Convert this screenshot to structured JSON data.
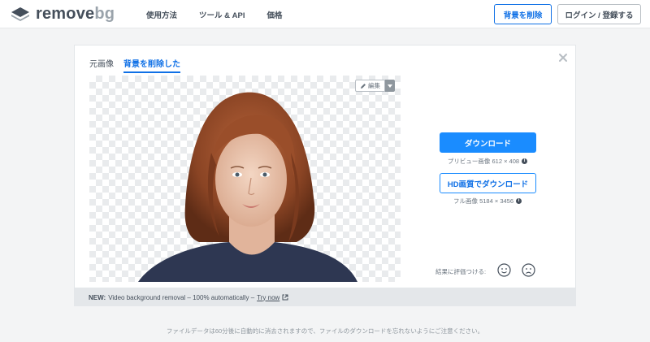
{
  "header": {
    "logo": {
      "text_main": "remove",
      "text_accent": "bg"
    },
    "nav": [
      {
        "label": "使用方法"
      },
      {
        "label": "ツール & API"
      },
      {
        "label": "価格"
      }
    ],
    "remove_bg_button": "背景を削除",
    "login_button": "ログイン / 登録する"
  },
  "card": {
    "tabs": [
      {
        "label": "元画像",
        "active": false
      },
      {
        "label": "背景を削除した",
        "active": true
      }
    ],
    "close_icon": "close-icon",
    "edit_button": "編集",
    "download": {
      "label": "ダウンロード",
      "info": "プリビュー画像 612 × 408"
    },
    "hd_download": {
      "label": "HD画質でダウンロード",
      "info": "フル画像 5184 × 3456"
    },
    "rating": {
      "label": "結果に評価つける:",
      "icons": [
        "smile-icon",
        "frown-icon"
      ]
    }
  },
  "banner": {
    "prefix": "NEW:",
    "text": "Video background removal – 100% automatically –",
    "link": "Try now"
  },
  "footer_note": "ファイルデータは60分後に自動的に消去されますので、ファイルのダウンロードを忘れないようにご注意ください。",
  "colors": {
    "accent": "#1a8cff",
    "accent_dark": "#0f70e6",
    "text": "#454f5b",
    "background": "#f3f4f5"
  }
}
